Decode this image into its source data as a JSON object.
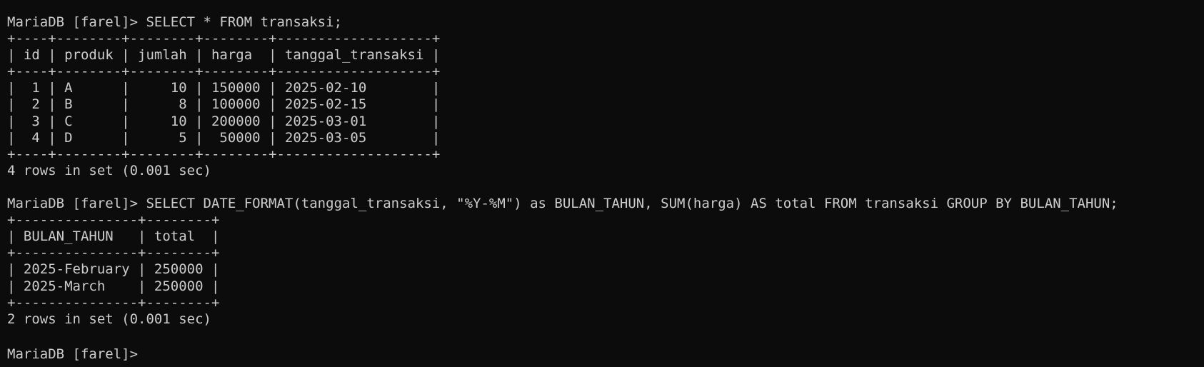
{
  "terminal": {
    "prompt": "MariaDB [farel]> ",
    "query1": {
      "command": "SELECT * FROM transaksi;",
      "table_lines": [
        "+----+--------+--------+--------+-------------------+",
        "| id | produk | jumlah | harga  | tanggal_transaksi |",
        "+----+--------+--------+--------+-------------------+",
        "|  1 | A      |     10 | 150000 | 2025-02-10        |",
        "|  2 | B      |      8 | 100000 | 2025-02-15        |",
        "|  3 | C      |     10 | 200000 | 2025-03-01        |",
        "|  4 | D      |      5 |  50000 | 2025-03-05        |",
        "+----+--------+--------+--------+-------------------+"
      ],
      "status": "4 rows in set (0.001 sec)"
    },
    "query2": {
      "command": "SELECT DATE_FORMAT(tanggal_transaksi, \"%Y-%M\") as BULAN_TAHUN, SUM(harga) AS total FROM transaksi GROUP BY BULAN_TAHUN;",
      "table_lines": [
        "+---------------+--------+",
        "| BULAN_TAHUN   | total  |",
        "+---------------+--------+",
        "| 2025-February | 250000 |",
        "| 2025-March    | 250000 |",
        "+---------------+--------+"
      ],
      "status": "2 rows in set (0.001 sec)"
    },
    "final_prompt": "MariaDB [farel]>"
  }
}
